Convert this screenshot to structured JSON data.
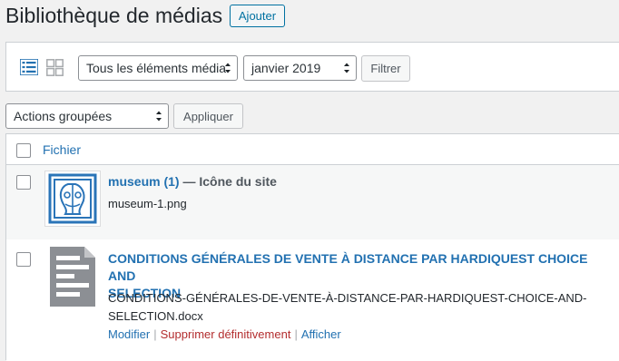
{
  "header": {
    "title": "Bibliothèque de médias",
    "add_label": "Ajouter"
  },
  "filters": {
    "type_select": "Tous les éléments média",
    "date_select": "janvier 2019",
    "filter_label": "Filtrer",
    "view_icons": [
      "list-view-icon",
      "grid-view-icon"
    ]
  },
  "bulk": {
    "select": "Actions groupées",
    "apply_label": "Appliquer"
  },
  "table": {
    "column_header": "Fichier",
    "rows": [
      {
        "title": "museum (1)",
        "suffix": " — Icône du site",
        "filename": "museum-1.png",
        "thumb_icon": "museum-thumbnail"
      },
      {
        "title_line1": "CONDITIONS GÉNÉRALES DE VENTE À DISTANCE PAR HARDIQUEST CHOICE AND",
        "title_line2": "SELECTION",
        "filename_line1": "CONDITIONS-GÉNÉRALES-DE-VENTE-À-DISTANCE-PAR-HARDIQUEST-CHOICE-AND-",
        "filename_line2": "SELECTION.docx",
        "thumb_icon": "document-icon",
        "actions": {
          "edit": "Modifier",
          "delete": "Supprimer définitivement",
          "separator": "|",
          "view": "Afficher"
        }
      }
    ]
  },
  "colors": {
    "link": "#2271b1",
    "delete": "#b32d2e",
    "background": "#f1f1f1"
  }
}
